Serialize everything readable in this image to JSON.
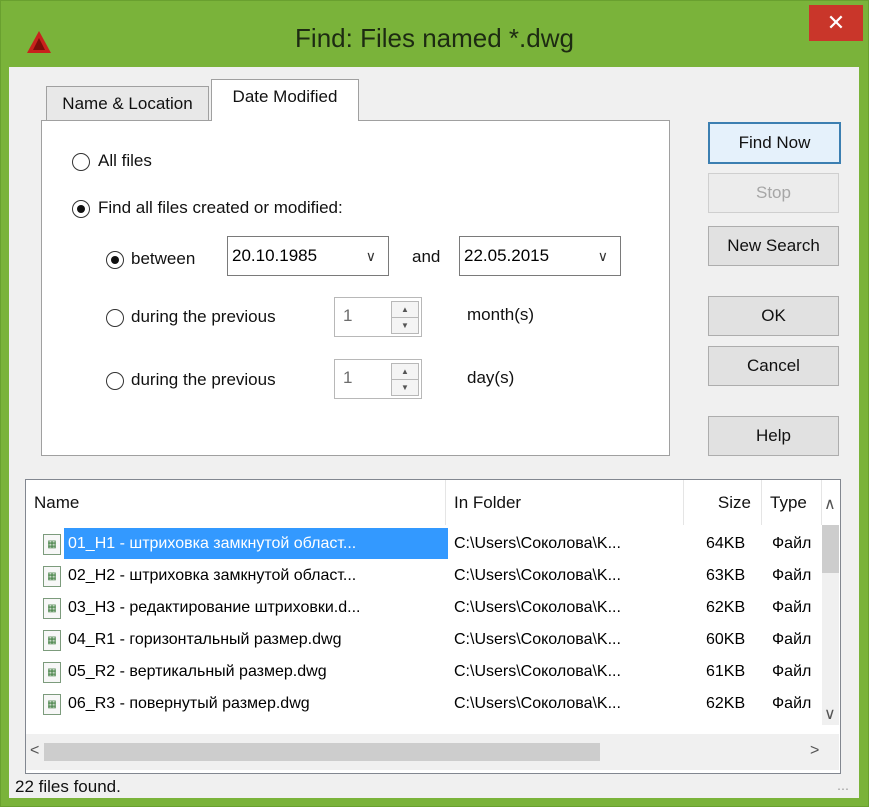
{
  "window": {
    "title": "Find: Files named *.dwg",
    "close_glyph": "✕",
    "accent": "#7ab33a"
  },
  "tabs": [
    {
      "label": "Name & Location"
    },
    {
      "label": "Date Modified",
      "active": true
    }
  ],
  "options": {
    "all_files": "All files",
    "find_all_modified": "Find all files created or modified:",
    "between": "between",
    "between_from": "20.10.1985",
    "and": "and",
    "between_to": "22.05.2015",
    "prev_months_label": "during the previous",
    "prev_months_value": "1",
    "months_unit": "month(s)",
    "prev_days_label": "during the previous",
    "prev_days_value": "1",
    "days_unit": "day(s)"
  },
  "buttons": {
    "find_now": "Find Now",
    "stop": "Stop",
    "new_search": "New Search",
    "ok": "OK",
    "cancel": "Cancel",
    "help": "Help"
  },
  "results": {
    "columns": [
      "Name",
      "In Folder",
      "Size",
      "Type"
    ],
    "rows": [
      {
        "name": "01_H1 - штриховка замкнутой област...",
        "folder": "C:\\Users\\Соколова\\K...",
        "size": "64KB",
        "type": "Файл"
      },
      {
        "name": "02_H2 - штриховка замкнутой област...",
        "folder": "C:\\Users\\Соколова\\K...",
        "size": "63KB",
        "type": "Файл"
      },
      {
        "name": "03_H3 - редактирование штриховки.d...",
        "folder": "C:\\Users\\Соколова\\K...",
        "size": "62KB",
        "type": "Файл"
      },
      {
        "name": "04_R1 - горизонтальный размер.dwg",
        "folder": "C:\\Users\\Соколова\\K...",
        "size": "60KB",
        "type": "Файл"
      },
      {
        "name": "05_R2 - вертикальный размер.dwg",
        "folder": "C:\\Users\\Соколова\\K...",
        "size": "61KB",
        "type": "Файл"
      },
      {
        "name": "06_R3 - повернутый размер.dwg",
        "folder": "C:\\Users\\Соколова\\K...",
        "size": "62KB",
        "type": "Файл"
      }
    ]
  },
  "status": "22 files found."
}
